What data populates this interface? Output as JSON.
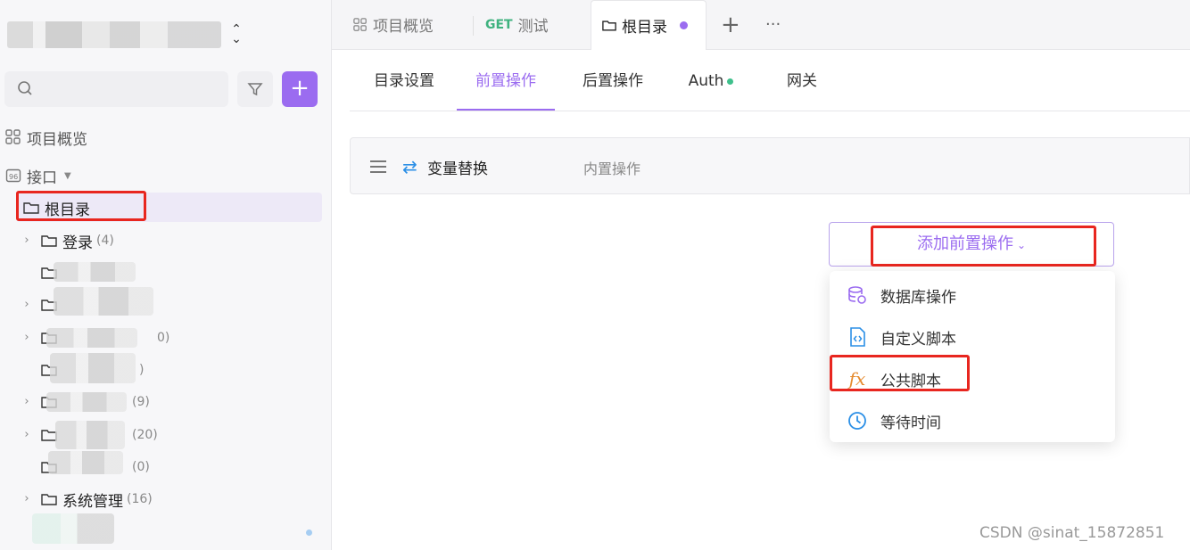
{
  "sidebar": {
    "nav": {
      "overview": "项目概览",
      "interfaces": "接口"
    },
    "tree": {
      "root": "根目录",
      "items": [
        {
          "name": "登录",
          "count": "(4)"
        },
        {
          "name": "",
          "count": ""
        },
        {
          "name": "",
          "count": ""
        },
        {
          "name": "",
          "count": "0)"
        },
        {
          "name": "",
          "count": ")"
        },
        {
          "name": "",
          "count": "(9)"
        },
        {
          "name": "",
          "count": "(20)"
        },
        {
          "name": "",
          "count": "(0)"
        },
        {
          "name": "系统管理",
          "count": "(16)"
        }
      ]
    }
  },
  "tabs": {
    "overview": "项目概览",
    "get_badge": "GET",
    "get_tab": "测试",
    "root_tab": "根目录",
    "add": "+",
    "more": "···"
  },
  "subtabs": {
    "dir_settings": "目录设置",
    "pre_ops": "前置操作",
    "post_ops": "后置操作",
    "auth": "Auth",
    "gateway": "网关"
  },
  "operation": {
    "name": "变量替换",
    "kind": "内置操作"
  },
  "add_pre_button": "添加前置操作",
  "menu": [
    {
      "label": "数据库操作",
      "icon": "database-icon"
    },
    {
      "label": "自定义脚本",
      "icon": "script-icon"
    },
    {
      "label": "公共脚本",
      "icon": "fx-icon"
    },
    {
      "label": "等待时间",
      "icon": "clock-icon"
    }
  ],
  "watermark": "CSDN @sinat_15872851",
  "colors": {
    "accent": "#9b6cf0",
    "highlight": "#e8261f",
    "green": "#3fc08c"
  }
}
